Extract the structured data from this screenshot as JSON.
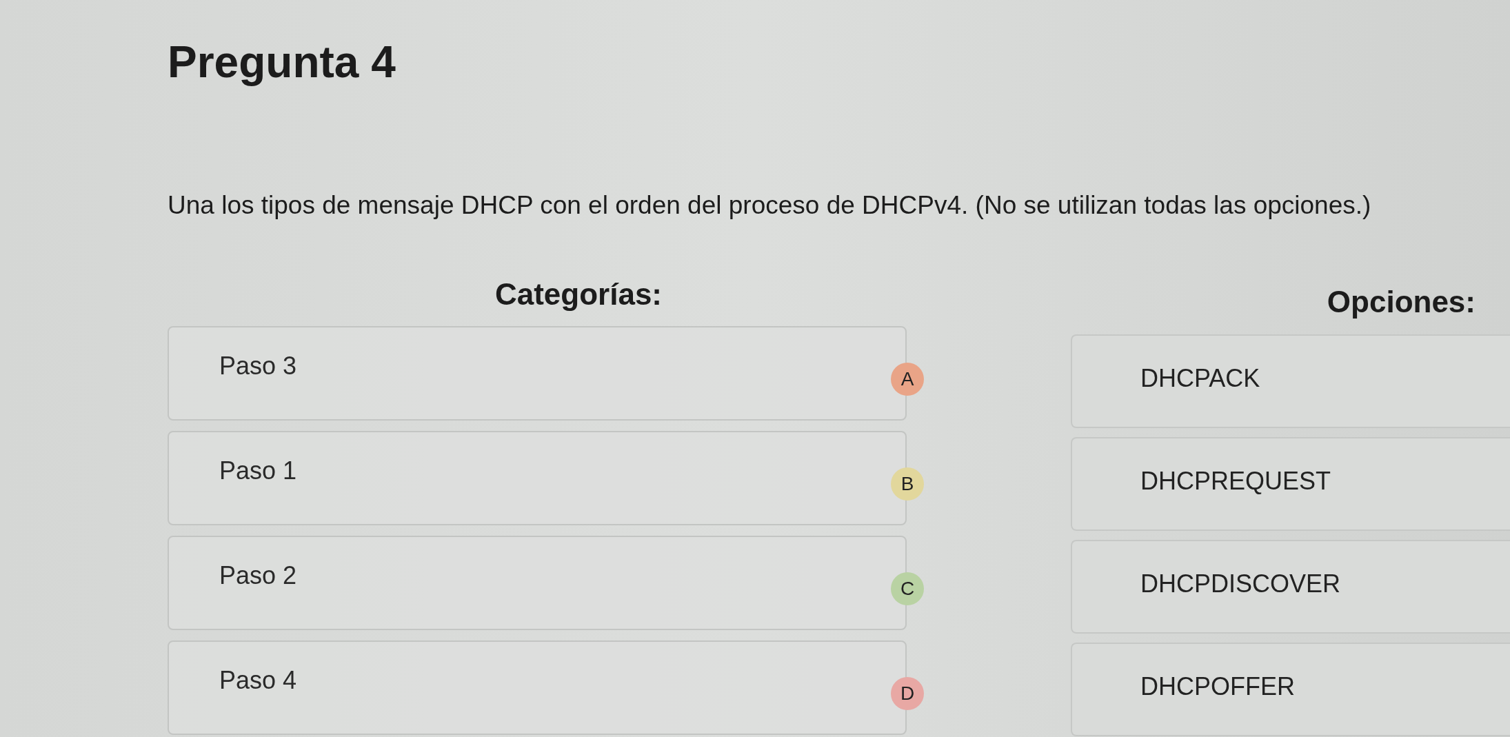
{
  "title": "Pregunta 4",
  "question": "Una los tipos de mensaje DHCP con el orden del proceso de DHCPv4. (No se utilizan todas las opciones.)",
  "categories_heading": "Categorías:",
  "categories": [
    {
      "label": "Paso 3",
      "marker": "A",
      "color": "#e9a487"
    },
    {
      "label": "Paso 1",
      "marker": "B",
      "color": "#e2d79c"
    },
    {
      "label": "Paso 2",
      "marker": "C",
      "color": "#b9d2a3"
    },
    {
      "label": "Paso 4",
      "marker": "D",
      "color": "#e8a8a4"
    }
  ],
  "options_heading": "Opciones:",
  "options": [
    "DHCPACK",
    "DHCPREQUEST",
    "DHCPDISCOVER",
    "DHCPOFFER"
  ]
}
